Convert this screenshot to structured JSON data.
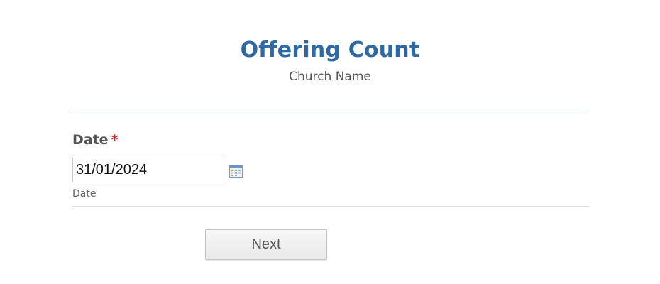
{
  "header": {
    "title": "Offering Count",
    "subtitle": "Church Name"
  },
  "date_field": {
    "label": "Date",
    "required_marker": "*",
    "value": "31/01/2024",
    "sublabel": "Date",
    "icon": "calendar-icon"
  },
  "navigation": {
    "next_label": "Next"
  },
  "colors": {
    "title": "#2e69a3",
    "required": "#e02b27",
    "divider": "#8fb3cf"
  }
}
